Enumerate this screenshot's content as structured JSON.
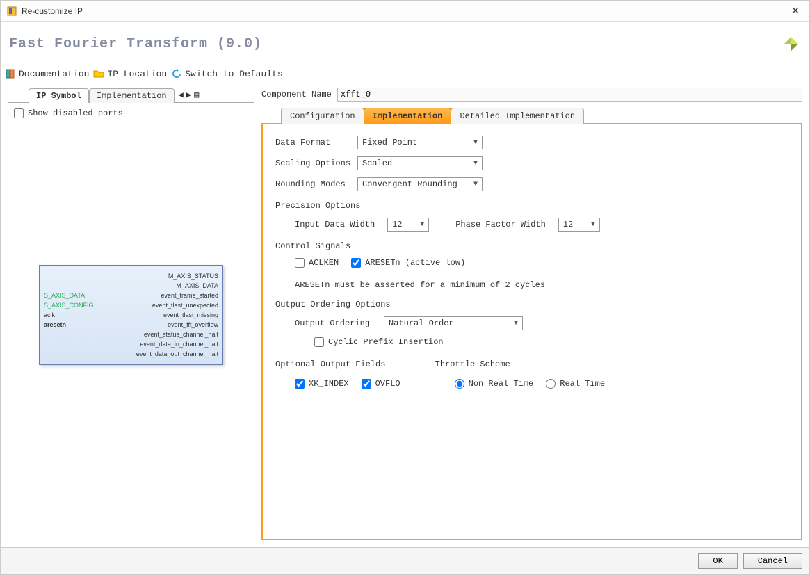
{
  "window": {
    "title": "Re-customize IP"
  },
  "header": {
    "title": "Fast Fourier Transform (9.0)"
  },
  "toolbar": {
    "documentation": "Documentation",
    "ip_location": "IP Location",
    "switch_defaults": "Switch to Defaults"
  },
  "left": {
    "tabs": [
      "IP Symbol",
      "Implementation"
    ],
    "show_disabled_ports": "Show disabled ports",
    "ip_block": {
      "left_ports": [
        "S_AXIS_DATA",
        "S_AXIS_CONFIG",
        "aclk",
        "aresetn"
      ],
      "right_ports": [
        "M_AXIS_STATUS",
        "M_AXIS_DATA",
        "event_frame_started",
        "event_tlast_unexpected",
        "event_tlast_missing",
        "event_fft_overflow",
        "event_status_channel_halt",
        "event_data_in_channel_halt",
        "event_data_out_channel_halt"
      ]
    }
  },
  "right": {
    "component_name_label": "Component Name",
    "component_name": "xfft_0",
    "tabs": [
      "Configuration",
      "Implementation",
      "Detailed Implementation"
    ],
    "form": {
      "data_format_label": "Data Format",
      "data_format": "Fixed Point",
      "scaling_label": "Scaling Options",
      "scaling": "Scaled",
      "rounding_label": "Rounding Modes",
      "rounding": "Convergent Rounding",
      "precision_title": "Precision Options",
      "input_width_label": "Input Data Width",
      "input_width": "12",
      "phase_width_label": "Phase Factor Width",
      "phase_width": "12",
      "control_title": "Control Signals",
      "aclken": "ACLKEN",
      "aresetn": "ARESETn (active low)",
      "aresetn_note": "ARESETn must be asserted for a minimum of 2 cycles",
      "output_order_title": "Output Ordering Options",
      "output_order_label": "Output Ordering",
      "output_order": "Natural Order",
      "cyclic_prefix": "Cyclic Prefix Insertion",
      "optional_fields_title": "Optional Output Fields",
      "xk_index": "XK_INDEX",
      "ovflo": "OVFLO",
      "throttle_title": "Throttle Scheme",
      "non_real_time": "Non Real Time",
      "real_time": "Real Time"
    }
  },
  "footer": {
    "ok": "OK",
    "cancel": "Cancel"
  }
}
